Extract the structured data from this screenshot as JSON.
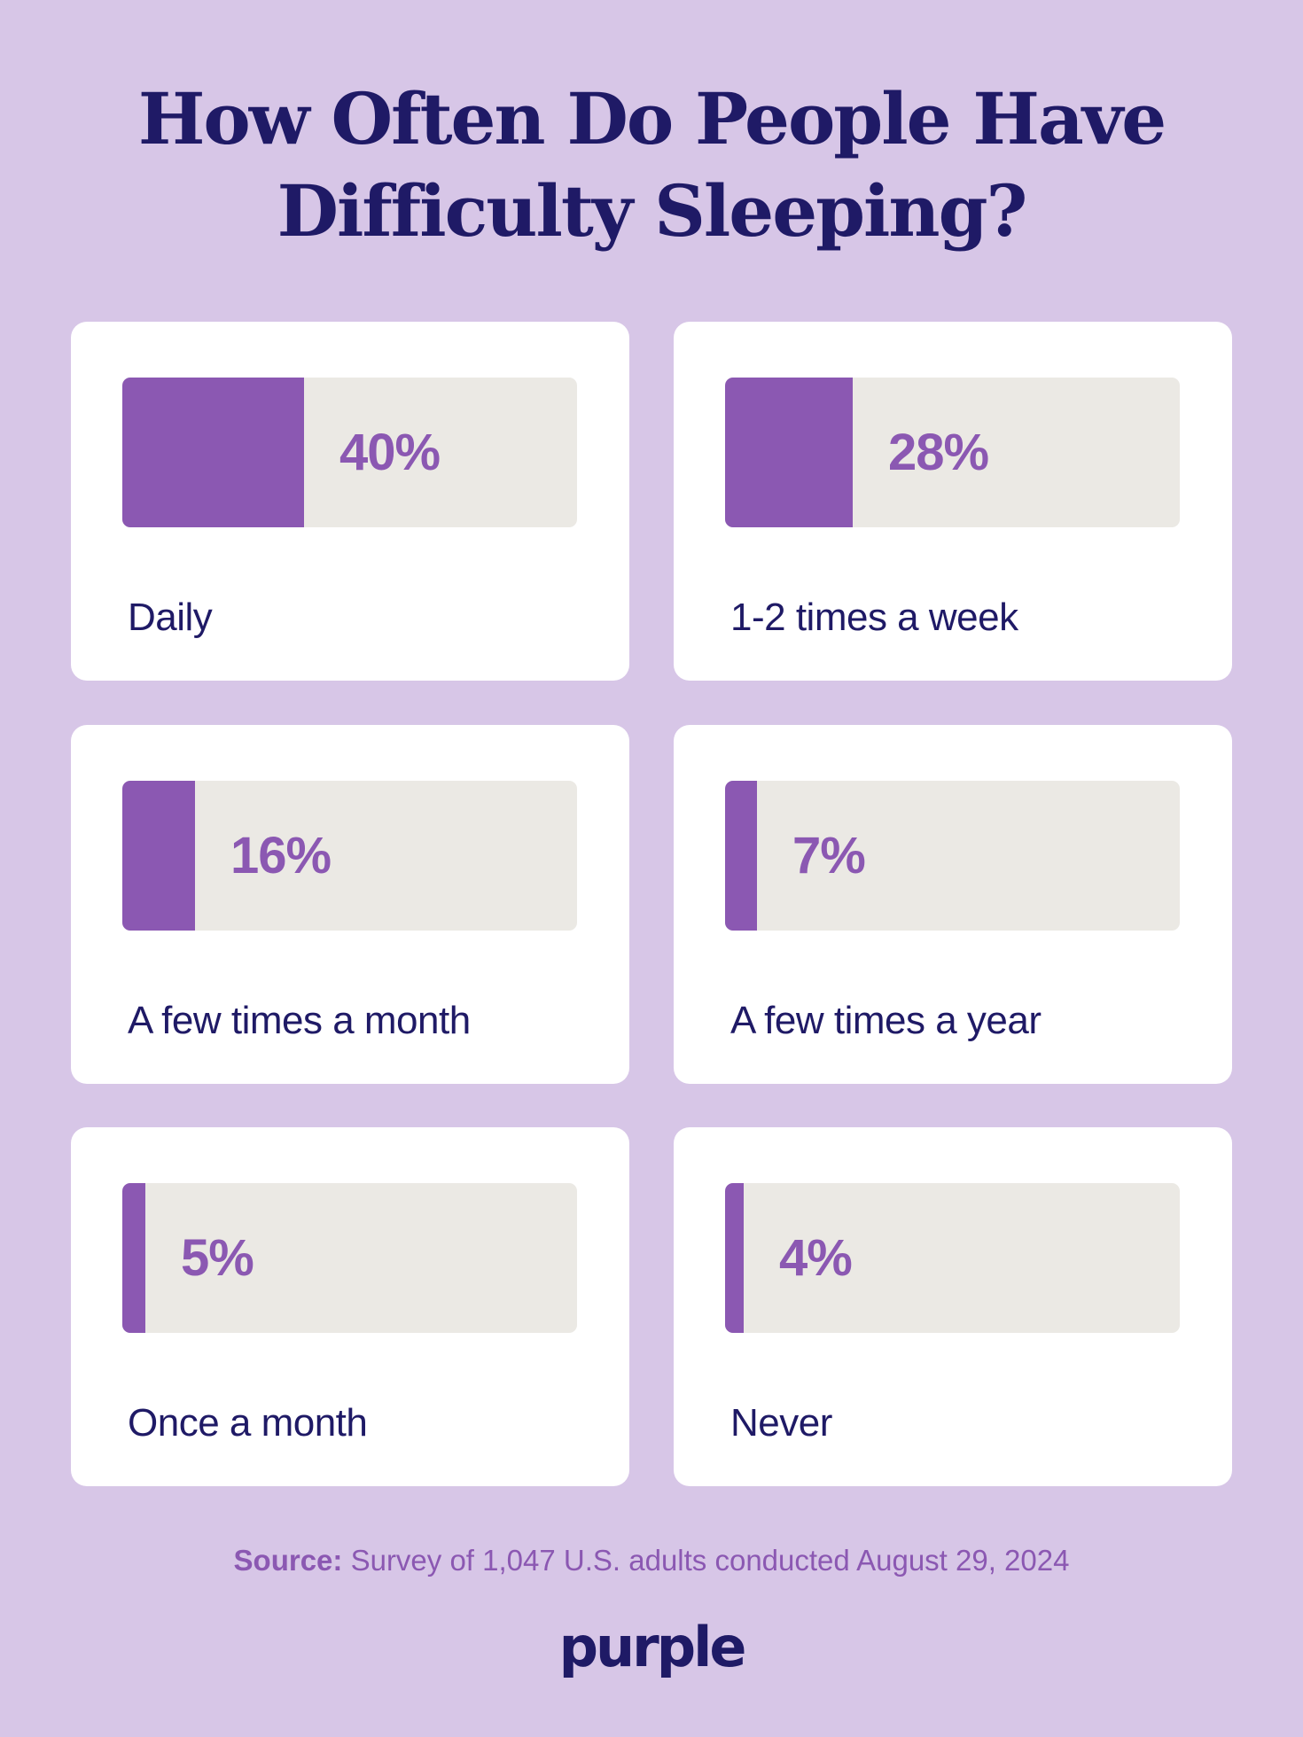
{
  "title": "How Often Do People Have Difficulty Sleeping?",
  "colors": {
    "background": "#d7c6e7",
    "card": "#ffffff",
    "bar_fill": "#8b58b2",
    "bar_track": "#ebe9e4",
    "heading_text": "#1f1a66",
    "value_text": "#8b58b2"
  },
  "chart_data": {
    "type": "bar",
    "title": "How Often Do People Have Difficulty Sleeping?",
    "xlabel": "",
    "ylabel": "",
    "ylim": [
      0,
      100
    ],
    "unit": "%",
    "categories": [
      "Daily",
      "1-2 times a week",
      "A few times a month",
      "A few times a year",
      "Once a month",
      "Never"
    ],
    "values": [
      40,
      28,
      16,
      7,
      5,
      4
    ],
    "value_labels": [
      "40%",
      "28%",
      "16%",
      "7%",
      "5%",
      "4%"
    ]
  },
  "source": {
    "label": "Source:",
    "text": "Survey of 1,047 U.S. adults conducted August 29, 2024"
  },
  "brand": {
    "logo_text": "purple"
  }
}
